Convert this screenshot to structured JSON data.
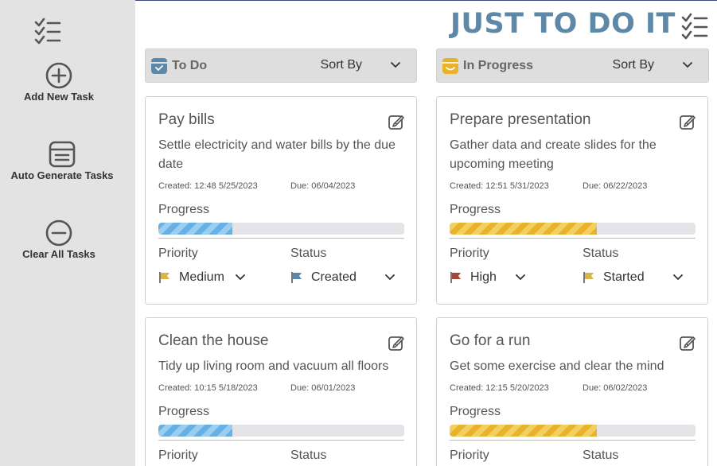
{
  "sidebar": {
    "logo_icon": "checklist-icon",
    "actions": [
      {
        "label": "Add New Task",
        "icon": "plus-circle-icon"
      },
      {
        "label": "Auto Generate Tasks",
        "icon": "stack-list-icon"
      },
      {
        "label": "Clear All Tasks",
        "icon": "minus-circle-icon"
      }
    ]
  },
  "brand": {
    "title": "JUST TO DO IT",
    "icon": "checklist-icon",
    "color": "#5d88a8"
  },
  "columns": [
    {
      "title": "To Do",
      "icon": "todo-box-icon",
      "icon_color": "#5d88a8",
      "sort_label": "Sort By",
      "cards": [
        {
          "title": "Pay bills",
          "description": "Settle electricity and water bills by the due date",
          "created": "Created: 12:48 5/25/2023",
          "due": "Due: 06/04/2023",
          "progress_label": "Progress",
          "progress": 0.3,
          "priority_label": "Priority",
          "priority": "Medium",
          "priority_flag_color": "#d9b44a",
          "status_label": "Status",
          "status": "Created",
          "status_flag_color": "#5d88a8"
        },
        {
          "title": "Clean the house",
          "description": "Tidy up living room and vacuum all floors",
          "created": "Created: 10:15 5/18/2023",
          "due": "Due: 06/01/2023",
          "progress_label": "Progress",
          "progress": 0.3,
          "priority_label": "Priority",
          "status_label": "Status"
        }
      ]
    },
    {
      "title": "In Progress",
      "icon": "progress-box-icon",
      "icon_color": "#e8b22a",
      "sort_label": "Sort By",
      "cards": [
        {
          "title": "Prepare presentation",
          "description": "Gather data and create slides for the upcoming meeting",
          "created": "Created: 12:51 5/31/2023",
          "due": "Due: 06/22/2023",
          "progress_label": "Progress",
          "progress": 0.6,
          "priority_label": "Priority",
          "priority": "High",
          "priority_flag_color": "#a2483a",
          "status_label": "Status",
          "status": "Started",
          "status_flag_color": "#d9b44a"
        },
        {
          "title": "Go for a run",
          "description": "Get some exercise and clear the mind",
          "created": "Created: 12:15 5/20/2023",
          "due": "Due: 06/02/2023",
          "progress_label": "Progress",
          "progress": 0.6,
          "priority_label": "Priority",
          "status_label": "Status"
        }
      ]
    }
  ]
}
